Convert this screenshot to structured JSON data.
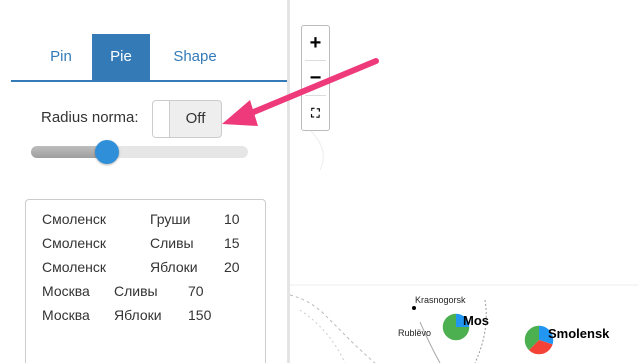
{
  "tabs": [
    {
      "label": "Pin",
      "active": false
    },
    {
      "label": "Pie",
      "active": true
    },
    {
      "label": "Shape",
      "active": false
    }
  ],
  "radius": {
    "label": "Radius norma:",
    "toggle_state": "Off",
    "slider_fraction": 0.35
  },
  "data_rows": [
    {
      "city": "Смоленск",
      "fruit": "Груши",
      "value": "10"
    },
    {
      "city": "Смоленск",
      "fruit": "Сливы",
      "value": "15"
    },
    {
      "city": "Смоленск",
      "fruit": "Яблоки",
      "value": "20"
    },
    {
      "city": "Москва",
      "fruit": "Сливы",
      "value": "70"
    },
    {
      "city": "Москва",
      "fruit": "Яблоки",
      "value": "150"
    }
  ],
  "map": {
    "zoom_in": "+",
    "zoom_out": "−",
    "fullscreen": "⛶",
    "labels": {
      "krasnogorsk": "Krasnogorsk",
      "rublevo": "Rublëvo",
      "moscow": "Mos",
      "smolensk": "Smolensk"
    },
    "pie_colors": [
      "#2196f3",
      "#4caf50",
      "#f44336"
    ]
  },
  "colors": {
    "accent": "#337ab7",
    "slider_handle": "#2f8fd8",
    "arrow": "#ee3a7a"
  }
}
